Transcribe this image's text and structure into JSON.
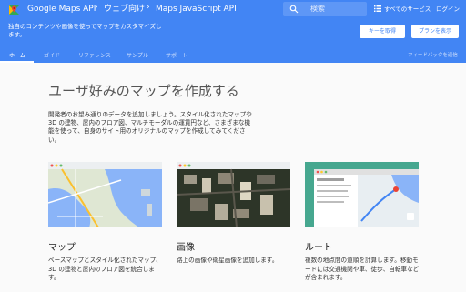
{
  "header": {
    "breadcrumb": [
      "Google Maps API",
      "ウェブ向け",
      "Maps JavaScript API"
    ],
    "search_placeholder": "検索",
    "all_services": "すべてのサービス",
    "login": "ログイン",
    "description": "独自のコンテンツや画像を使ってマップをカスタマイズします。",
    "get_key_label": "キーを取得",
    "plans_label": "プランを表示",
    "tabs": [
      {
        "label": "ホーム",
        "active": true
      },
      {
        "label": "ガイド",
        "active": false
      },
      {
        "label": "リファレンス",
        "active": false
      },
      {
        "label": "サンプル",
        "active": false
      },
      {
        "label": "サポート",
        "active": false
      }
    ],
    "feedback": "フィードバックを送信"
  },
  "main": {
    "title": "ユーザ好みのマップを作成する",
    "intro": "開発者のお望み通りのデータを追加しましょう。スタイル化されたマップや 3D の建物、屋内のフロア図、マルチモーダルの運賃円など、さまざまな機能を使って、自身のサイト用のオリジナルのマップを作成してみてください。",
    "cards": [
      {
        "title": "マップ",
        "text": "ベースマップとスタイル化されたマップ、3D の建物と屋内のフロア図を統合します。"
      },
      {
        "title": "画像",
        "text": "路上の画像や衛星画像を追加します。"
      },
      {
        "title": "ルート",
        "text": "複数の地点間の道順を計算します。移動モードには交通機関や車、徒歩、自転車などが含まれます。"
      }
    ]
  },
  "colors": {
    "brand": "#4285f4",
    "background": "#fafafa"
  }
}
